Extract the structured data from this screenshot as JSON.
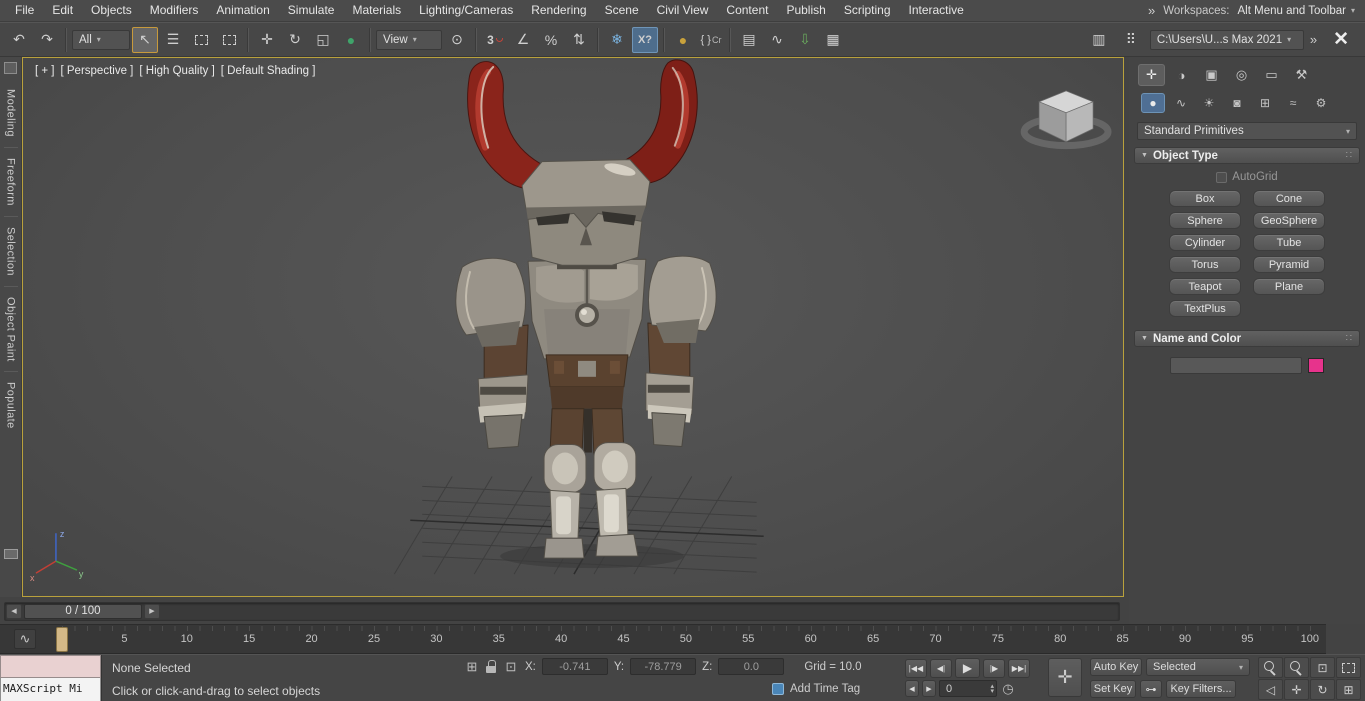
{
  "colors": {
    "accent_pink": "#e7338c",
    "viewport_border": "#b9a13c",
    "active_tool_outline": "#c79a3c",
    "active_blue": "#4e6d8c",
    "time_marker_tan": "#d3b887"
  },
  "menubar": {
    "items": [
      "File",
      "Edit",
      "Objects",
      "Modifiers",
      "Animation",
      "Simulate",
      "Materials",
      "Lighting/Cameras",
      "Rendering",
      "Scene",
      "Civil View",
      "Content",
      "Publish",
      "Scripting",
      "Interactive"
    ],
    "overflow": "»",
    "workspaces_label": "Workspaces:",
    "workspaces_value": "Alt Menu and Toolbar"
  },
  "toolbar": {
    "selection_filter_value": "All",
    "coordsys_value": "View",
    "project_path": "C:\\Users\\U...s Max 2021",
    "braces_label": "Cr",
    "overflow": "»"
  },
  "icons": {
    "undo": "↶",
    "redo": "↷",
    "select_object": "↖",
    "select_by_name": "☰",
    "move": "✛",
    "rotate": "↻",
    "scale": "◱",
    "place": "●",
    "pivot_center": "⊙",
    "snap_3d": "3",
    "angle_snap": "∠",
    "percent_snap": "%",
    "spinner_snap": "⇅",
    "snowflake": "❄",
    "xview": "X?",
    "material_sphere": "●",
    "braces": "{ }",
    "layers": "▤",
    "curve_editor": "∿",
    "down_arrow": "⇩",
    "grid_panel": "▦",
    "striped_box": "▥",
    "dots_grid": "⠿",
    "dropdown_arrow": "▾",
    "close": "✕"
  },
  "panel_icons": {
    "create": "✛",
    "modify": "◑",
    "hierarchy": "▣",
    "motion": "◎",
    "display": "▭",
    "utilities": "⚒",
    "geometry": "●",
    "shapes": "∿",
    "lights": "☀",
    "cameras": "◙",
    "helpers": "⊞",
    "spacewarps": "≈",
    "systems": "⚙",
    "rollout_arrow": "▼",
    "rollout_dots": "∷"
  },
  "status_icons": {
    "gizmo": "⊞",
    "absolute": "⊡",
    "go_start": "|◀◀",
    "prev_key": "◀|",
    "play": "▶",
    "next_key": "|▶",
    "go_end": "▶▶|",
    "frame_back": "◀",
    "frame_fwd": "▶",
    "spin_up": "▴",
    "spin_down": "▾",
    "time_config": "◷",
    "set_keys": "✛",
    "key_pair": "⊶",
    "zoom_extents": "⊡",
    "fov": "◁",
    "pan": "✛",
    "orbit": "↻",
    "maximize": "⊞",
    "mini_curve": "∿"
  },
  "ribbon_tabs": [
    "Modeling",
    "Freeform",
    "Selection",
    "Object Paint",
    "Populate"
  ],
  "viewport": {
    "label_plus": "[ + ]",
    "label_view": "[ Perspective ]",
    "label_quality": "[ High Quality ]",
    "label_shading": "[ Default Shading ]",
    "axis_x": "x",
    "axis_y": "y",
    "axis_z": "z"
  },
  "command_panel": {
    "category_dropdown": "Standard Primitives",
    "object_type": {
      "title": "Object Type",
      "autogrid_label": "AutoGrid",
      "buttons": [
        "Box",
        "Cone",
        "Sphere",
        "GeoSphere",
        "Cylinder",
        "Tube",
        "Torus",
        "Pyramid",
        "Teapot",
        "Plane",
        "TextPlus"
      ]
    },
    "name_color": {
      "title": "Name and Color",
      "name_value": "",
      "color_swatch": "#e7338c"
    }
  },
  "time_slider": {
    "value": "0 / 100",
    "prev": "◀",
    "next": "▶"
  },
  "track_bar": {
    "ticks": [
      "0",
      "5",
      "10",
      "15",
      "20",
      "25",
      "30",
      "35",
      "40",
      "45",
      "50",
      "55",
      "60",
      "65",
      "70",
      "75",
      "80",
      "85",
      "90",
      "95",
      "100"
    ]
  },
  "status_bar": {
    "maxscript_text": "MAXScript Mi",
    "selection_status": "None Selected",
    "prompt": "Click or click-and-drag to select objects",
    "x_label": "X:",
    "x_value": "-0.741",
    "y_label": "Y:",
    "y_value": "-78.779",
    "z_label": "Z:",
    "z_value": "0.0",
    "grid_label": "Grid = 10.0",
    "add_time_tag": "Add Time Tag",
    "frame_value": "0",
    "auto_key": "Auto Key",
    "set_key": "Set Key",
    "key_mode_dropdown": "Selected",
    "key_filters": "Key Filters..."
  }
}
